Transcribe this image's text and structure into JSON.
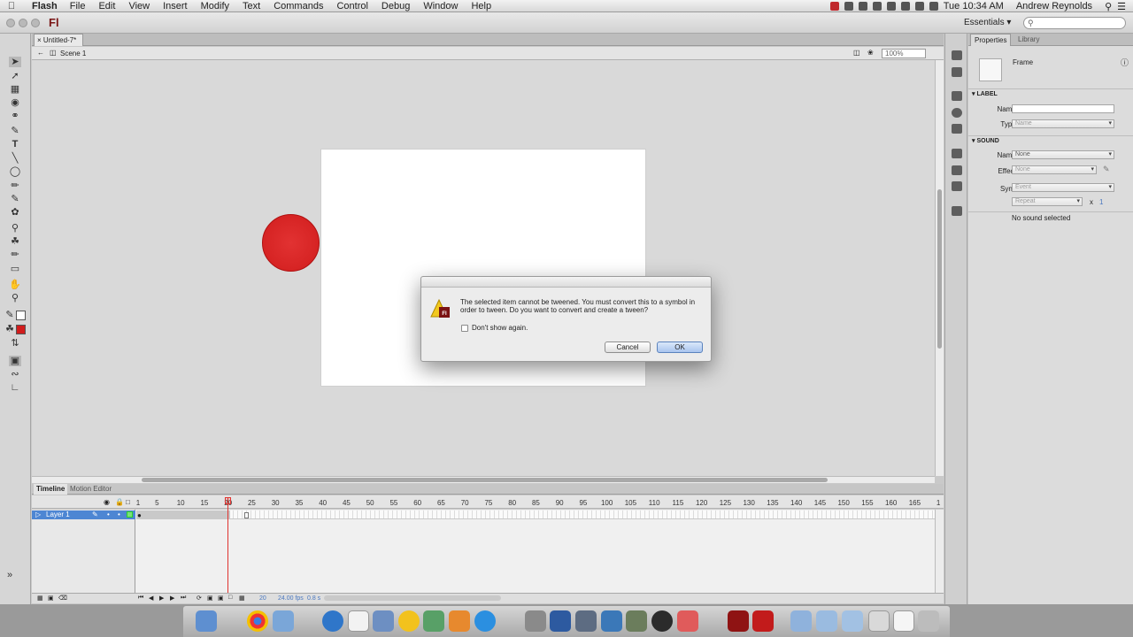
{
  "menubar": {
    "app_name": "Flash",
    "items": [
      "File",
      "Edit",
      "View",
      "Insert",
      "Modify",
      "Text",
      "Commands",
      "Control",
      "Debug",
      "Window",
      "Help"
    ],
    "clock": "Tue 10:34 AM",
    "user": "Andrew Reynolds"
  },
  "appbar": {
    "logo": "Fl",
    "workspace": "Essentials ▾"
  },
  "document": {
    "tab_title": "Untitled-7*",
    "scene": "Scene 1",
    "zoom": "100%"
  },
  "stage": {
    "circle_color": "#d11d1d",
    "stage_color": "#ffffff"
  },
  "dialog": {
    "message": "The selected item cannot be tweened. You must convert this to a symbol in order to tween. Do you want to convert and create a tween?",
    "checkbox_label": "Don't show again.",
    "cancel_label": "Cancel",
    "ok_label": "OK"
  },
  "timeline": {
    "tabs": [
      "Timeline",
      "Motion Editor"
    ],
    "frame_numbers": [
      "1",
      "5",
      "10",
      "15",
      "20",
      "25",
      "30",
      "35",
      "40",
      "45",
      "50",
      "55",
      "60",
      "65",
      "70",
      "75",
      "80",
      "85",
      "90",
      "95",
      "100",
      "105",
      "110",
      "115",
      "120",
      "125",
      "130",
      "135",
      "140",
      "145",
      "150",
      "155",
      "160",
      "165",
      "1"
    ],
    "layer_name": "Layer 1",
    "current_frame": "20",
    "fps": "24.00 fps",
    "elapsed": "0.8 s"
  },
  "properties": {
    "tabs": [
      "Properties",
      "Library"
    ],
    "object_type": "Frame",
    "label_section": "LABEL",
    "label_name_label": "Name:",
    "label_name_value": "",
    "label_type_label": "Type:",
    "label_type_value": "Name",
    "sound_section": "SOUND",
    "sound_name_label": "Name:",
    "sound_name_value": "None",
    "effect_label": "Effect:",
    "effect_value": "None",
    "sync_label": "Sync:",
    "sync_value": "Event",
    "repeat_value": "Repeat",
    "repeat_x": "x",
    "repeat_count": "1",
    "no_sound": "No sound selected"
  }
}
